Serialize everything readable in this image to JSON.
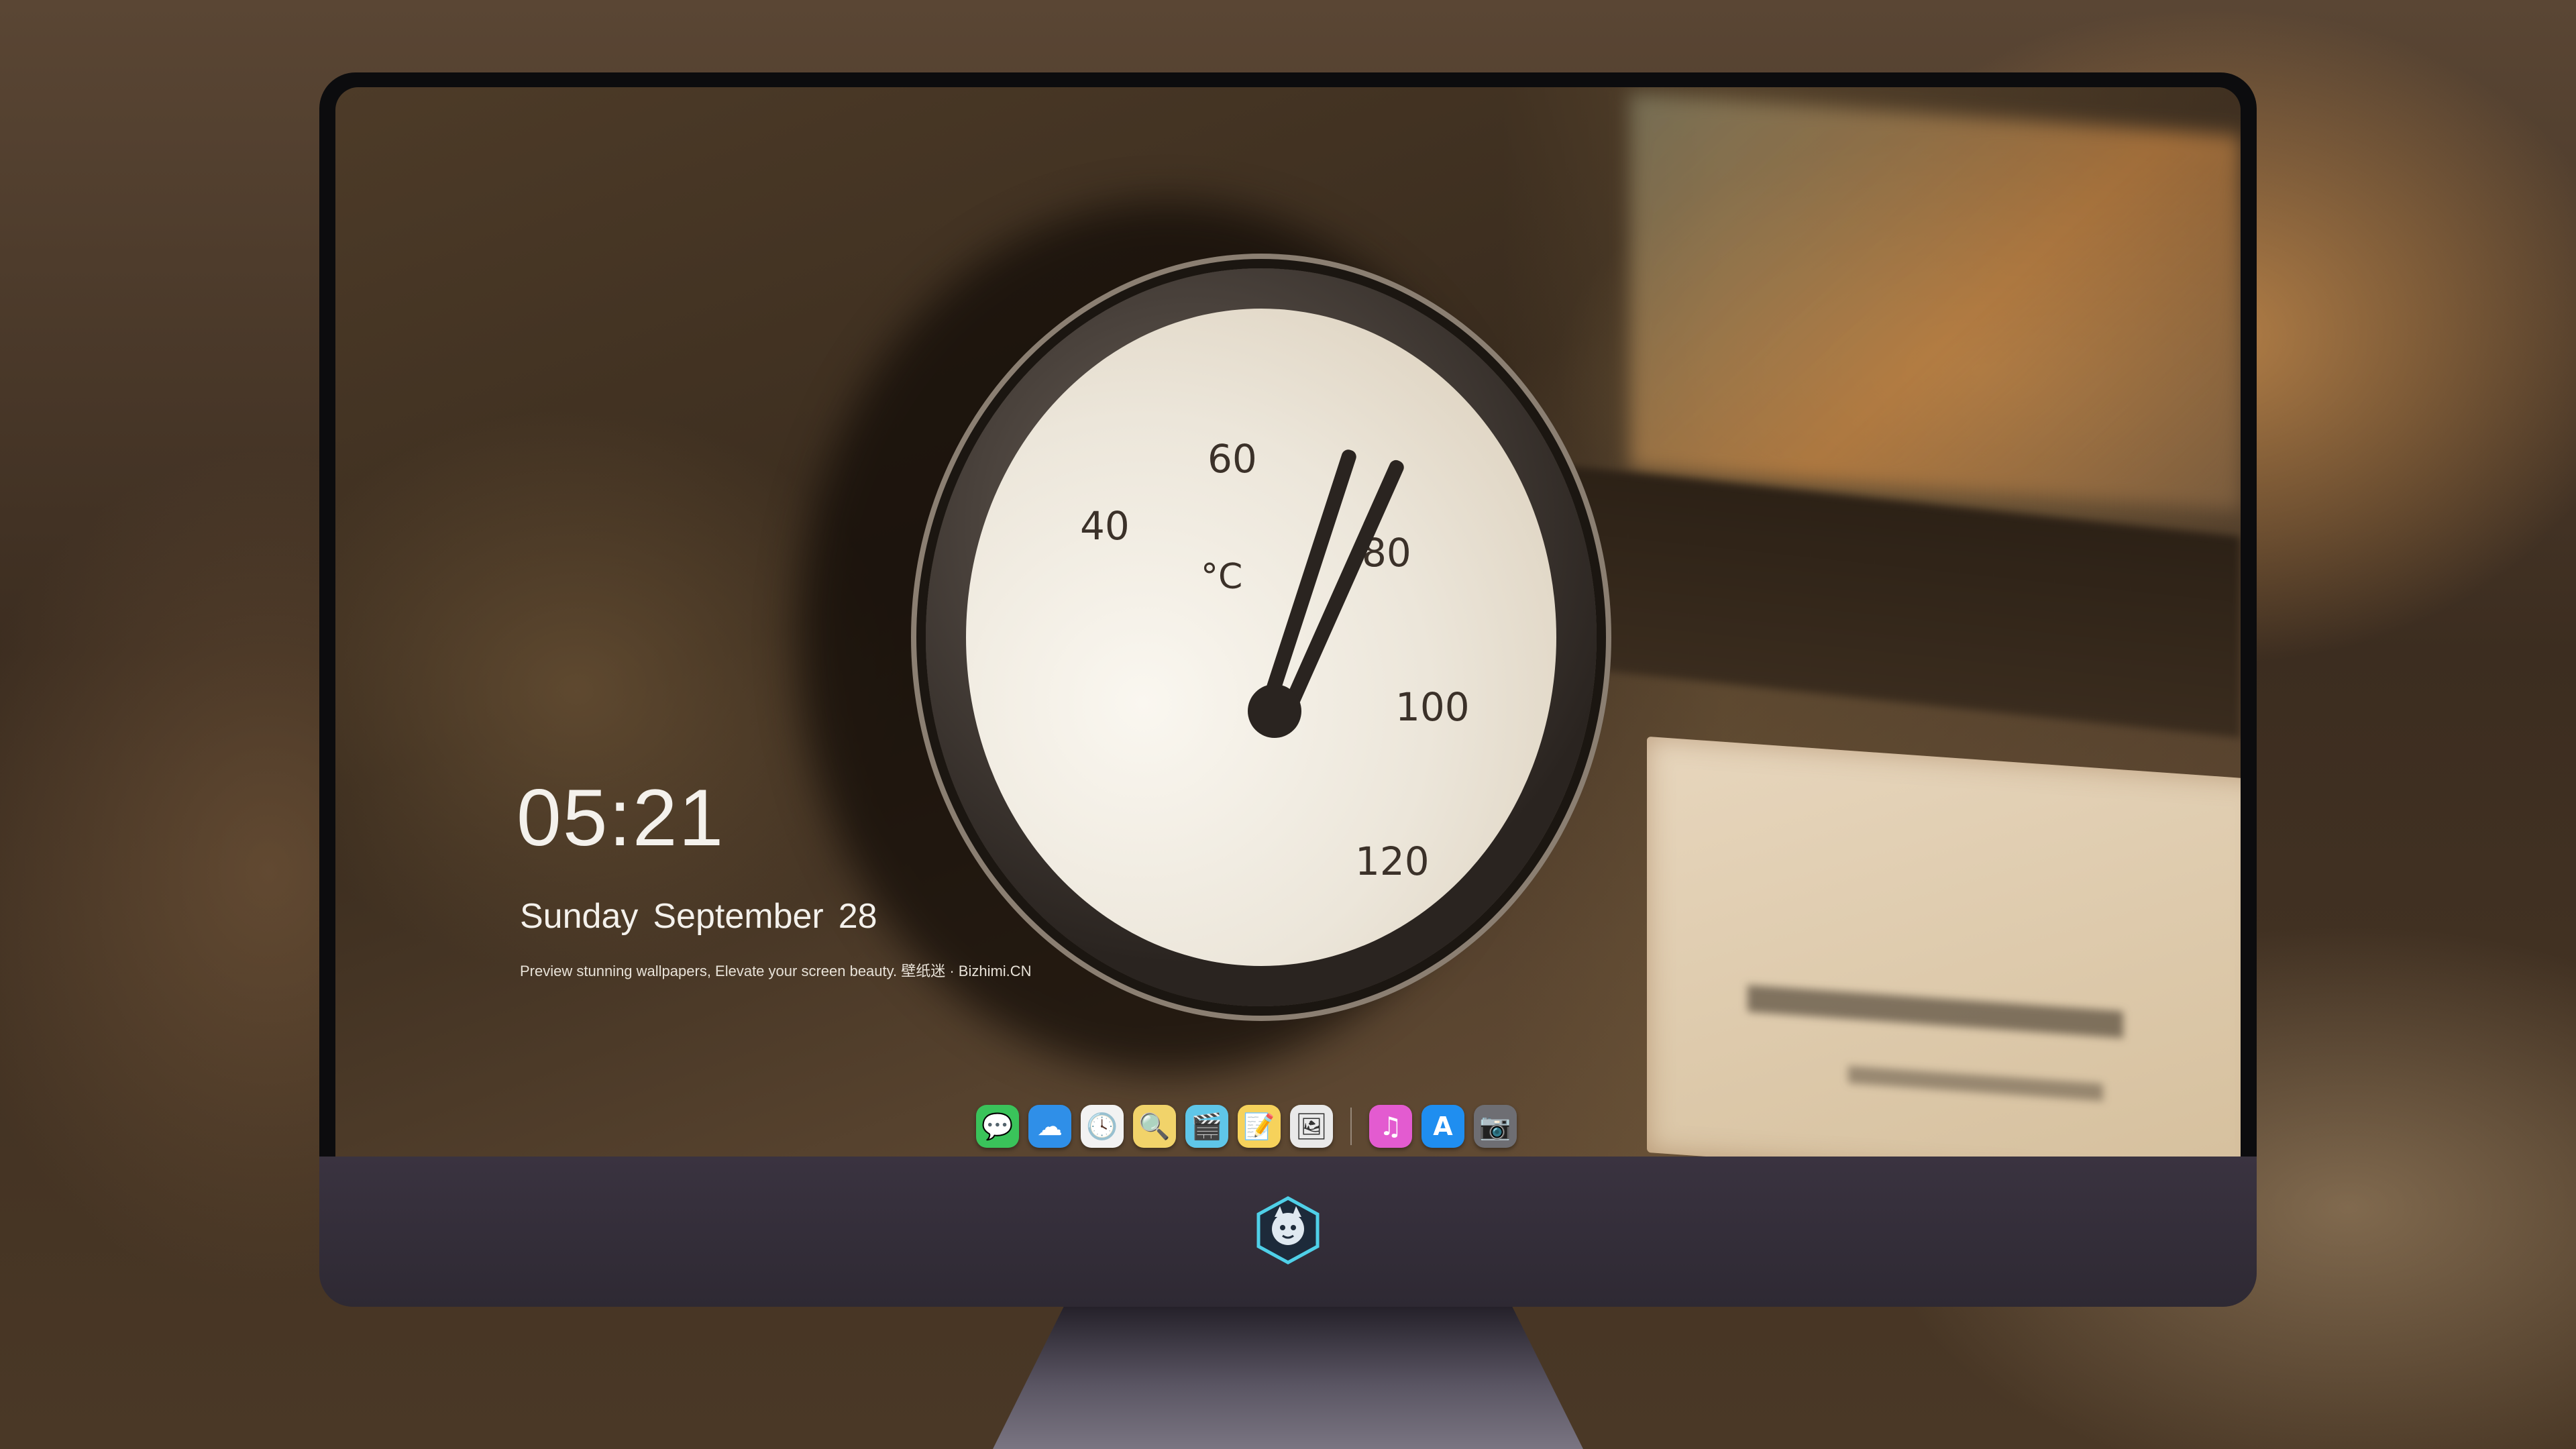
{
  "lock_screen": {
    "time": "05:21",
    "date_weekday": "Sunday",
    "date_month": "September",
    "date_day": "28",
    "tagline": "Preview stunning wallpapers, Elevate your screen beauty. 壁纸迷 · Bizhimi.CN"
  },
  "wallpaper": {
    "gauge_labels": [
      "40",
      "60",
      "°C",
      "80",
      "100",
      "120"
    ]
  },
  "dock": {
    "items": [
      {
        "name": "messages",
        "icon": "message-bubble-icon",
        "color": "#3ac35a",
        "glyph": "💬"
      },
      {
        "name": "weather",
        "icon": "cloud-icon",
        "color": "#2f8fe8",
        "glyph": "☁"
      },
      {
        "name": "clock",
        "icon": "clock-icon",
        "color": "#f2f2f2",
        "glyph": "🕓"
      },
      {
        "name": "preview",
        "icon": "preview-icon",
        "color": "#f1d36a",
        "glyph": "🔍"
      },
      {
        "name": "clips",
        "icon": "clapperboard-icon",
        "color": "#5fc6e8",
        "glyph": "🎬"
      },
      {
        "name": "notes",
        "icon": "notes-icon",
        "color": "#f6d25b",
        "glyph": "📝"
      },
      {
        "name": "photos",
        "icon": "photos-icon",
        "color": "#e9e9e9",
        "glyph": "🖼"
      },
      {
        "name": "music",
        "icon": "music-note-icon",
        "color": "#e35bd0",
        "glyph": "♫"
      },
      {
        "name": "app-store",
        "icon": "app-store-icon",
        "color": "#1f8ef0",
        "glyph": "A"
      },
      {
        "name": "camera",
        "icon": "camera-icon",
        "color": "#6e6e73",
        "glyph": "📷"
      }
    ]
  },
  "colors": {
    "clock_text": "#f4f1ec",
    "chin": "#3a3340",
    "bezel": "#0c0c0e"
  }
}
